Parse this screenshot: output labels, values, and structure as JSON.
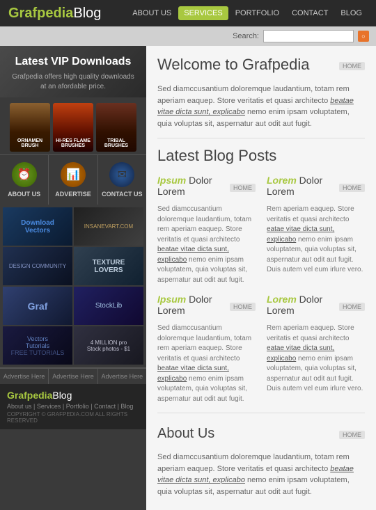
{
  "header": {
    "logo": {
      "graf": "Grafpedia",
      "blog": "Blog"
    },
    "nav": [
      {
        "label": "ABOUT US",
        "active": false
      },
      {
        "label": "SERVICES",
        "active": true
      },
      {
        "label": "PORTFOLIO",
        "active": false
      },
      {
        "label": "CONTACT",
        "active": false
      },
      {
        "label": "BLOG",
        "active": false
      }
    ]
  },
  "search": {
    "label": "Search:",
    "placeholder": ""
  },
  "sidebar": {
    "vip_title": "Latest VIP Downloads",
    "vip_desc": "Grafpedia offers high quality downloads at an afordable price.",
    "products": [
      {
        "label": "ORNAMEN\nBRUSH"
      },
      {
        "label": "HI-RES FLAME\nBRUSHES"
      },
      {
        "label": "TRIBAL\nBRUSHES"
      }
    ],
    "icons": [
      {
        "icon": "⏰",
        "label": "ABOUT US",
        "color": "green"
      },
      {
        "icon": "📊",
        "label": "ADVERTISE",
        "color": "orange"
      },
      {
        "icon": "✉",
        "label": "CONTACT US",
        "color": "blue"
      }
    ],
    "advertise": [
      "Advertise Here",
      "Advertise Here",
      "Advertise Here"
    ],
    "footer": {
      "logo_green": "Grafpedia",
      "logo_white": "Blog",
      "links": "About us | Services | Portfolio | Contact | Blog",
      "copyright": "COPYRIGHT © GRAFPEDIA.COM ALL RIGHTS RESERVED"
    }
  },
  "content": {
    "welcome": {
      "title": "Welcome to Grafpedia",
      "home_tag": "HOME",
      "text": "Sed diamccusantium doloremque laudantium, totam rem aperiam eaquep. Store veritatis et quasi architecto beatae vitae dicta sunt, explicabo nemo enim ipsam voluptatem, quia voluptas sit, aspernatur aut odit aut fugit."
    },
    "blog_posts": {
      "title": "Latest Blog Posts",
      "posts": [
        {
          "title_highlight": "Ipsum",
          "title_normal": " Dolor Lorem",
          "text": "Sed diamccusantium doloremque laudantium, totam rem aperiam eaquep. Store veritatis et quasi architecto beatae vitae dicta sunt, explicabo nemo enim ipsam voluptatem, quia voluptas sit, aspernatur aut odit aut fugit.",
          "home_tag": "HOME"
        },
        {
          "title_highlight": "Lorem",
          "title_normal": " Dolor Lorem",
          "text": "Rem aperiam eaquep. Store veritatis et quasi architecto eatae vitae dicta sunt, explicabo nemo enim ipsam voluptatem, quia voluptas sit, aspernatur aut odit aut fugit. Duis autem vel eum irlure vero.",
          "home_tag": "HOME"
        },
        {
          "title_highlight": "Ipsum",
          "title_normal": " Dolor Lorem",
          "text": "Sed diamccusantium doloremque laudantium, totam rem aperiam eaquep. Store veritatis et quasi architecto beatae vitae dicta sunt, explicabo nemo enim ipsam voluptatem, quia voluptas sit, aspernatur aut odit aut fugit.",
          "home_tag": "HOME"
        },
        {
          "title_highlight": "Lorem",
          "title_normal": " Dolor Lorem",
          "text": "Rem aperiam eaquep. Store veritatis et quasi architecto eatae vitae dicta sunt, explicabo nemo enim ipsam voluptatem, quia voluptas sit, aspernatur aut odit aut fugit. Duis autem vel eum irlure vero.",
          "home_tag": "HOME"
        }
      ]
    },
    "about": {
      "title": "About Us",
      "text": "Sed diamccusantium doloremque laudantium, totam rem aperiam eaquep. Store veritatis et quasi architecto beatae vitae dicta sunt, explicabo nemo enim ipsam voluptatem, quia voluptas sit, aspernatur aut odit aut fugit.",
      "home_tag": "HOME"
    }
  }
}
